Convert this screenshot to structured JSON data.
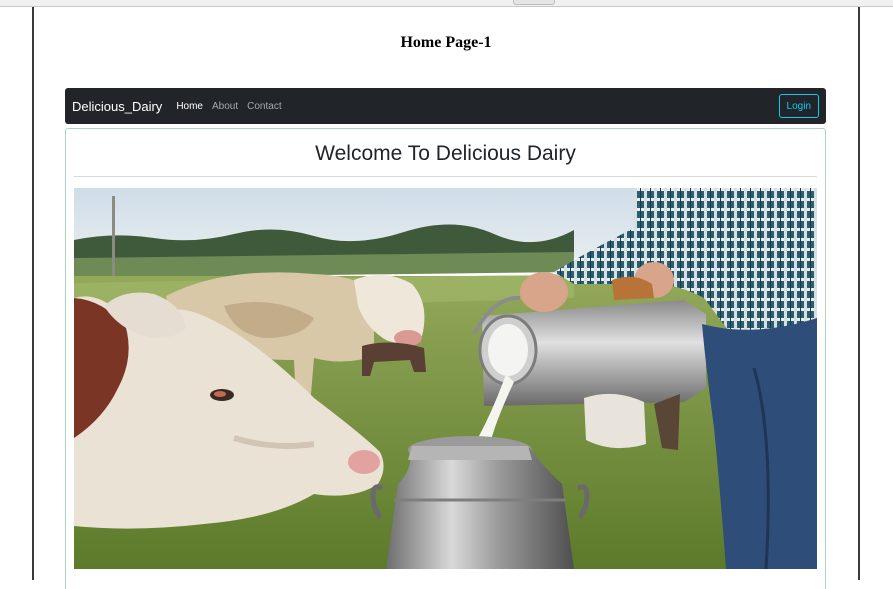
{
  "document": {
    "title": "Home Page-1"
  },
  "navbar": {
    "brand": "Delicious_Dairy",
    "links": [
      {
        "label": "Home",
        "active": true
      },
      {
        "label": "About",
        "active": false
      },
      {
        "label": "Contact",
        "active": false
      }
    ],
    "login_label": "Login"
  },
  "card": {
    "title": "Welcome To Delicious Dairy"
  },
  "colors": {
    "navbar_bg": "#212529",
    "login_accent": "#0dcaf0",
    "card_border": "#a8d8c4"
  }
}
